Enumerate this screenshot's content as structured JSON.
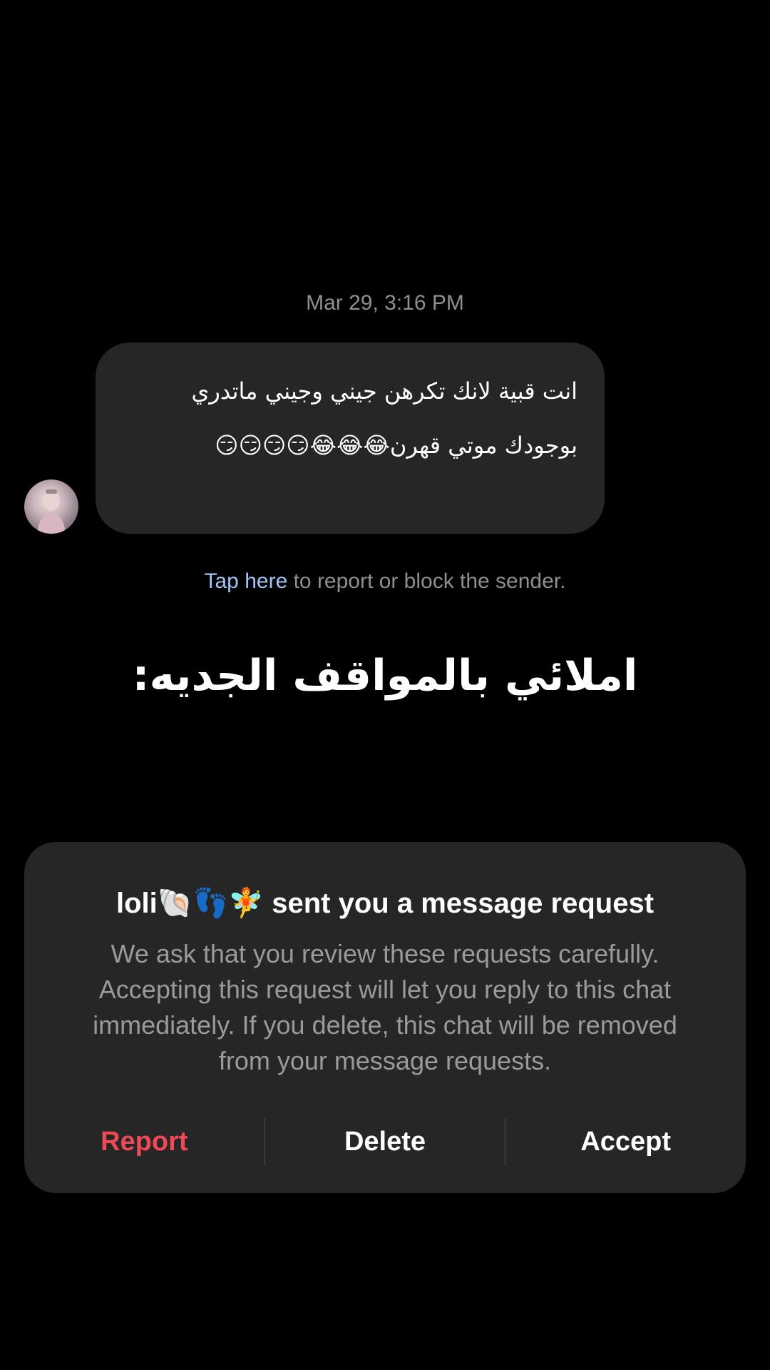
{
  "thread": {
    "timestamp": "Mar 29, 3:16 PM",
    "message_text": "انت قبية لانك تكرهن جيني وجيني ماتدري بوجودك موتي قهرن😂😂😂😏😏😏😏",
    "avatar_icon": "user-avatar-photo"
  },
  "report_hint": {
    "link_text": "Tap here",
    "rest_text": " to report or block the sender."
  },
  "caption": "املائي بالمواقف الجديه:",
  "request": {
    "title": "loli🐚👣🧚 sent you a message request",
    "body": "We ask that you review these requests carefully. Accepting this request will let you reply to this chat immediately. If you delete, this chat will be removed from your message requests.",
    "actions": {
      "report": "Report",
      "delete": "Delete",
      "accept": "Accept"
    },
    "colors": {
      "report": "#ed4956",
      "card_background": "#262626",
      "link": "#9ec4f5"
    }
  }
}
